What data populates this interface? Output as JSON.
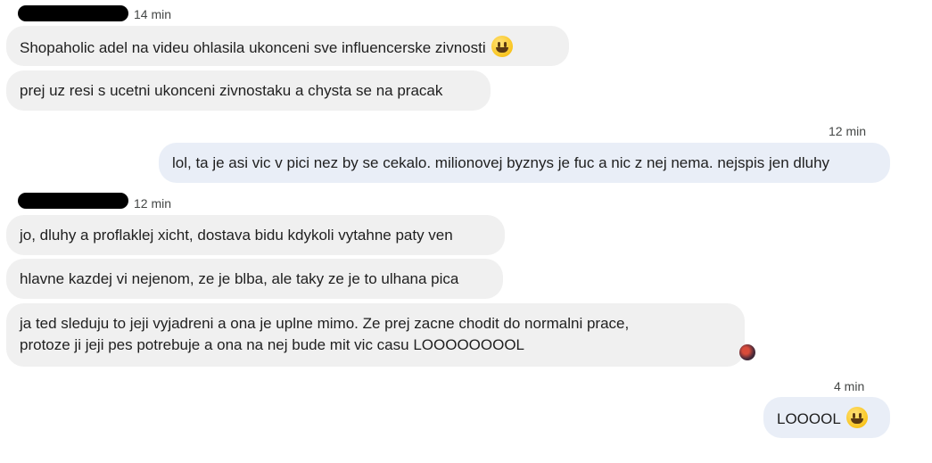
{
  "messages": [
    {
      "sender": "incoming",
      "time": "14 min",
      "text": "Shopaholic adel na videu ohlasila ukonceni sve influencerske zivnosti",
      "emoji": "grinning-face-icon"
    },
    {
      "sender": "incoming",
      "text": "prej uz resi s ucetni ukonceni zivnostaku a chysta se na pracak"
    },
    {
      "sender": "outgoing",
      "time": "12 min",
      "text": "lol, ta je asi vic v pici nez by se cekalo. milionovej byznys je fuc a nic z nej nema. nejspis jen dluhy"
    },
    {
      "sender": "incoming",
      "time": "12 min",
      "text": "jo, dluhy a proflaklej xicht, dostava bidu kdykoli vytahne paty ven"
    },
    {
      "sender": "incoming",
      "text": "hlavne kazdej vi nejenom, ze je blba, ale taky ze je to ulhana pica"
    },
    {
      "sender": "incoming",
      "lines": [
        "ja ted sleduju to jeji vyjadreni a ona je uplne mimo. Ze prej zacne chodit do normalni prace,",
        "protoze ji jeji pes potrebuje a ona na nej bude mit vic casu LOOOOOOOOL"
      ]
    },
    {
      "sender": "outgoing",
      "time": "4 min",
      "text": "LOOOOL",
      "emoji": "grinning-face-icon"
    }
  ],
  "colors": {
    "incoming_bubble": "#f0f0f0",
    "outgoing_bubble": "#e9eef7",
    "meta_text": "#444746"
  }
}
